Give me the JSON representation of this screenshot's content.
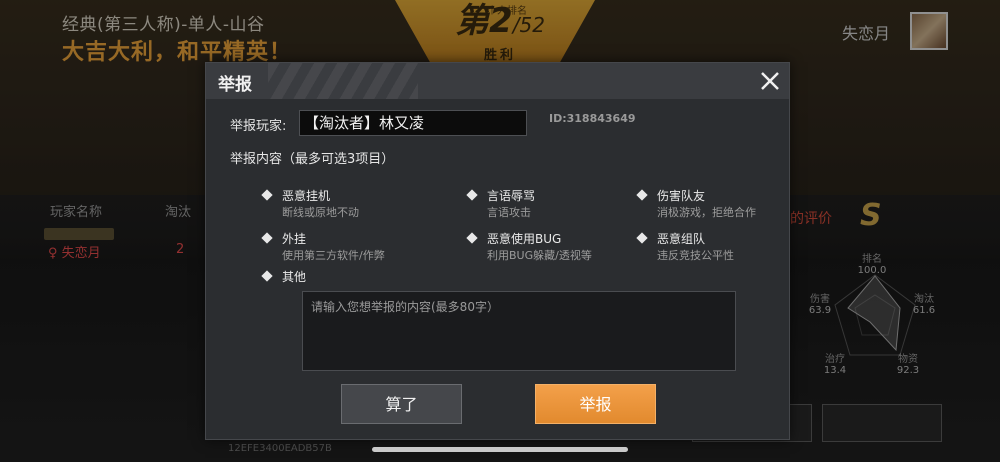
{
  "background": {
    "mode_title": "经典(第三人称)-单人-山谷",
    "slogan": "大吉大利，和平精英！",
    "rank": {
      "caption": "个人排名",
      "number": "第2",
      "total": "/52",
      "result": "胜利"
    },
    "player_name": "失恋月",
    "table_headers": {
      "name": "玩家名称",
      "kills": "淘汰"
    },
    "row": {
      "badge": "",
      "name": "失恋月",
      "kills": "2"
    },
    "evaluation_title": "的评价",
    "grade": "S",
    "radar": [
      {
        "label": "排名",
        "value": "100.0"
      },
      {
        "label": "淘汰",
        "value": "61.6"
      },
      {
        "label": "物资",
        "value": "92.3"
      },
      {
        "label": "治疗",
        "value": "13.4"
      },
      {
        "label": "伤害",
        "value": "63.9"
      }
    ],
    "match_id": "12EFE3400EADB57B"
  },
  "modal": {
    "title": "举报",
    "player_label": "举报玩家:",
    "player_value": "【淘汰者】林又凌",
    "player_id": "ID:318843649",
    "content_label": "举报内容（最多可选3项目）",
    "options": [
      {
        "title": "恶意挂机",
        "desc": "断线或原地不动"
      },
      {
        "title": "言语辱骂",
        "desc": "言语攻击"
      },
      {
        "title": "伤害队友",
        "desc": "消极游戏，拒绝合作"
      },
      {
        "title": "外挂",
        "desc": "使用第三方软件/作弊"
      },
      {
        "title": "恶意使用BUG",
        "desc": "利用BUG躲藏/透视等"
      },
      {
        "title": "恶意组队",
        "desc": "违反竞技公平性"
      },
      {
        "title": "其他",
        "desc": ""
      }
    ],
    "textarea_placeholder": "请输入您想举报的内容(最多80字）",
    "cancel_label": "算了",
    "report_label": "举报"
  },
  "colors": {
    "accent_orange": "#e8903a",
    "danger_red": "#e24a4a",
    "slogan_gold": "#e8a23a"
  }
}
